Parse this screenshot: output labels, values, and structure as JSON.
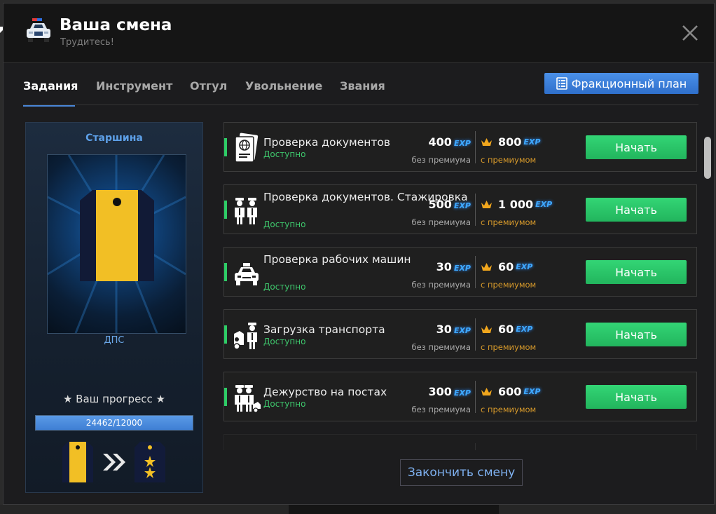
{
  "header": {
    "title": "Ваша смена",
    "subtitle": "Трудитесь!",
    "icon": "police-car-icon"
  },
  "tabs": [
    {
      "label": "Задания",
      "active": true
    },
    {
      "label": "Инструмент",
      "active": false
    },
    {
      "label": "Отгул",
      "active": false
    },
    {
      "label": "Увольнение",
      "active": false
    },
    {
      "label": "Звания",
      "active": false
    }
  ],
  "plan_button": {
    "label": "Фракционный план",
    "icon": "clipboard-icon"
  },
  "rank": {
    "name": "Старшина",
    "group": "ДПС",
    "progress_label": "★ Ваш прогресс ★",
    "progress_text": "24462/12000",
    "progress_fraction": 1.0
  },
  "tasks": [
    {
      "name": "Проверка документов",
      "status": "Доступно",
      "exp_base": "400",
      "exp_premium": "800",
      "icon": "passport-icon"
    },
    {
      "name": "Проверка документов. Стажировка",
      "status": "Доступно",
      "exp_base": "500",
      "exp_premium": "1 000",
      "icon": "officers-icon"
    },
    {
      "name": "Проверка рабочих машин",
      "status": "Доступно",
      "exp_base": "30",
      "exp_premium": "60",
      "icon": "taxi-car-icon"
    },
    {
      "name": "Загрузка транспорта",
      "status": "Доступно",
      "exp_base": "30",
      "exp_premium": "60",
      "icon": "tow-officer-icon"
    },
    {
      "name": "Дежурство на постах",
      "status": "Доступно",
      "exp_base": "300",
      "exp_premium": "600",
      "icon": "post-duty-icon"
    }
  ],
  "labels": {
    "exp": "EXP",
    "base": "без премиума",
    "premium": "с премиумом",
    "start": "Начать"
  },
  "end_shift_button": "Закончить смену",
  "colors": {
    "accent": "#4a86d8",
    "green": "#2ecc66",
    "premium": "#d99b2b",
    "exp": "#3fa9ff"
  }
}
